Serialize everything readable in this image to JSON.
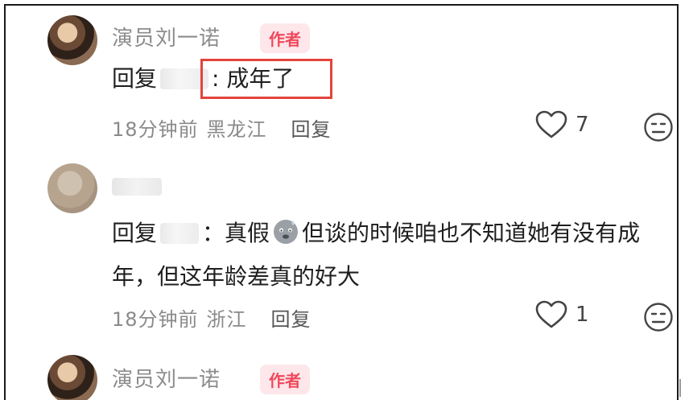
{
  "comments": [
    {
      "username": "演员刘一诺",
      "badge": "作者",
      "reply_prefix": "回复",
      "reply_colon": ":",
      "reply_body": "成年了",
      "time": "18分钟前",
      "location": "黑龙江",
      "reply_label": "回复",
      "likes": "7"
    },
    {
      "reply_prefix": "回复",
      "reply_colon": "：",
      "reply_body_1": "真假",
      "reply_body_2": "但谈的时候咱也不知道她有没",
      "reply_body_3": "有成年，但这年龄差真的好大",
      "time": "18分钟前",
      "location": "浙江",
      "reply_label": "回复",
      "likes": "1"
    },
    {
      "username": "演员刘一诺",
      "badge": "作者"
    }
  ],
  "icons": {
    "heart": "heart-outline-icon",
    "emoji": "neutral-face-icon",
    "inline_emoji": "sweating-face-emoji"
  },
  "colors": {
    "badge_bg": "#fde7ea",
    "badge_text": "#f0485c",
    "highlight": "#e3443b"
  }
}
